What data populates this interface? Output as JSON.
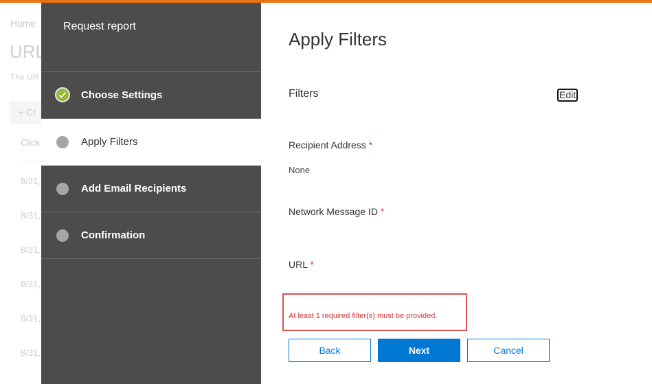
{
  "background": {
    "breadcrumb": "Home",
    "page_title": "URL",
    "description": "The UR",
    "create_button": "Cr",
    "column_header": "Click",
    "rows": [
      "8/31,",
      "8/31,",
      "8/31,",
      "8/31,",
      "8/31,",
      "8/31,",
      "8/31,",
      "8/31"
    ]
  },
  "wizard": {
    "title": "Request report",
    "steps": [
      {
        "label": "Choose Settings",
        "state": "complete"
      },
      {
        "label": "Apply Filters",
        "state": "current"
      },
      {
        "label": "Add Email Recipients",
        "state": "pending"
      },
      {
        "label": "Confirmation",
        "state": "pending"
      }
    ]
  },
  "content": {
    "heading": "Apply Filters",
    "filters_label": "Filters",
    "edit_label": "Edit",
    "fields": [
      {
        "label": "Recipient Address",
        "required": "*",
        "value": "None"
      },
      {
        "label": "Network Message ID",
        "required": "*",
        "value": ""
      },
      {
        "label": "URL",
        "required": "*",
        "value": ""
      }
    ],
    "error": "At least 1 required filter(s) must be provided."
  },
  "buttons": {
    "back": "Back",
    "next": "Next",
    "cancel": "Cancel"
  },
  "colors": {
    "accent_top": "#e8730f",
    "primary": "#0078d4",
    "error": "#d13438",
    "panel": "#4c4c4c",
    "check": "#96b83c"
  }
}
